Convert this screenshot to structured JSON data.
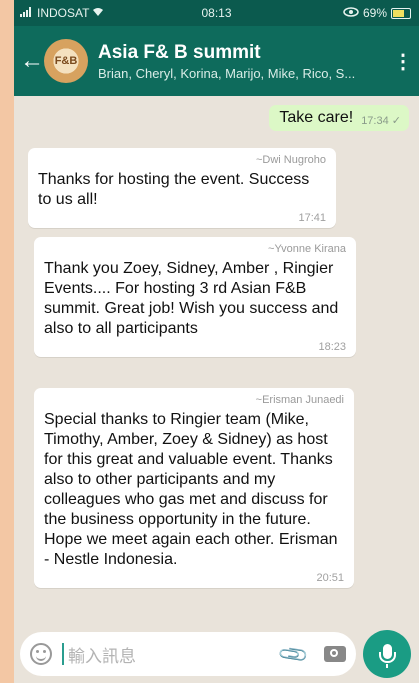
{
  "statusbar": {
    "carrier": "INDOSAT",
    "time": "08:13",
    "battery": "69%",
    "battery_level": 0.69
  },
  "header": {
    "group_name": "Asia F& B summit",
    "members": "Brian, Cheryl, Korina, Marijo, Mike, Rico, S...",
    "avatar_text": "F&B"
  },
  "messages": {
    "sent": {
      "text": "Take care!",
      "time": "17:34"
    },
    "received": [
      {
        "sender": "~Dwi Nugroho",
        "text": "Thanks for hosting the event. Success to us all!",
        "time": "17:41"
      },
      {
        "sender": "~Yvonne Kirana",
        "text": "Thank you Zoey,  Sidney,  Amber , Ringier Events....  For hosting 3 rd Asian F&B summit. Great job! Wish you success and also to all participants",
        "time": "18:23"
      },
      {
        "sender": "~Erisman Junaedi",
        "text": "Special thanks to Ringier team (Mike, Timothy, Amber, Zoey & Sidney) as host for this great and valuable event. Thanks also to other participants and my colleagues who gas met and discuss for the business opportunity in the future. Hope we meet again each other. Erisman - Nestle Indonesia.",
        "time": "20:51"
      }
    ]
  },
  "input": {
    "placeholder": "輸入訊息"
  },
  "colors": {
    "header": "#0e6b5c",
    "statusbar": "#0b5a4e",
    "sent_bubble": "#dcf8c6",
    "mic": "#1a9c84",
    "chat_bg": "#e9e3da"
  },
  "icons": [
    "signal-icon",
    "wifi-icon",
    "eye-icon",
    "back-arrow-icon",
    "menu-icon",
    "emoji-icon",
    "attach-icon",
    "camera-icon",
    "mic-icon",
    "checkmark-icon"
  ]
}
